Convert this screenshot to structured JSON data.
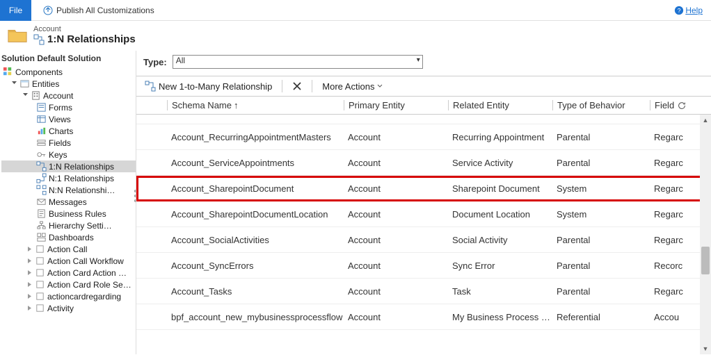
{
  "topbar": {
    "file_label": "File",
    "publish_label": "Publish All Customizations",
    "help_label": "Help"
  },
  "header": {
    "entity_label": "Account",
    "page_title": "1:N Relationships"
  },
  "sidebar": {
    "solution_label": "Solution Default Solution",
    "components_label": "Components",
    "entities_label": "Entities",
    "account_label": "Account",
    "children": {
      "forms": "Forms",
      "views": "Views",
      "charts": "Charts",
      "fields": "Fields",
      "keys": "Keys",
      "rel_1n": "1:N Relationships",
      "rel_n1": "N:1 Relationships",
      "rel_nn": "N:N Relationshi…",
      "messages": "Messages",
      "br": "Business Rules",
      "hier": "Hierarchy Setti…",
      "dash": "Dashboards"
    },
    "others": {
      "action_call": "Action Call",
      "action_call_wf": "Action Call Workflow",
      "action_card": "Action Card Action …",
      "action_card_role": "Action Card Role Se…",
      "acr": "actioncardregarding",
      "activity": "Activity"
    }
  },
  "filter": {
    "type_label": "Type:",
    "type_value": "All"
  },
  "toolbar": {
    "new_label": "New 1-to-Many Relationship",
    "more_label": "More Actions"
  },
  "grid": {
    "headers": {
      "schema": "Schema Name",
      "primary": "Primary Entity",
      "related": "Related Entity",
      "behavior": "Type of Behavior",
      "field": "Field"
    },
    "rows": [
      {
        "schema": "Account_RecurringAppointmentMasters",
        "primary": "Account",
        "related": "Recurring Appointment",
        "behavior": "Parental",
        "field": "Regarc",
        "hl": false
      },
      {
        "schema": "Account_ServiceAppointments",
        "primary": "Account",
        "related": "Service Activity",
        "behavior": "Parental",
        "field": "Regarc",
        "hl": false
      },
      {
        "schema": "Account_SharepointDocument",
        "primary": "Account",
        "related": "Sharepoint Document",
        "behavior": "System",
        "field": "Regarc",
        "hl": true
      },
      {
        "schema": "Account_SharepointDocumentLocation",
        "primary": "Account",
        "related": "Document Location",
        "behavior": "System",
        "field": "Regarc",
        "hl": false
      },
      {
        "schema": "Account_SocialActivities",
        "primary": "Account",
        "related": "Social Activity",
        "behavior": "Parental",
        "field": "Regarc",
        "hl": false
      },
      {
        "schema": "Account_SyncErrors",
        "primary": "Account",
        "related": "Sync Error",
        "behavior": "Parental",
        "field": "Recorc",
        "hl": false
      },
      {
        "schema": "Account_Tasks",
        "primary": "Account",
        "related": "Task",
        "behavior": "Parental",
        "field": "Regarc",
        "hl": false
      },
      {
        "schema": "bpf_account_new_mybusinessprocessflow",
        "primary": "Account",
        "related": "My Business Process F…",
        "behavior": "Referential",
        "field": "Accou",
        "hl": false
      }
    ]
  }
}
